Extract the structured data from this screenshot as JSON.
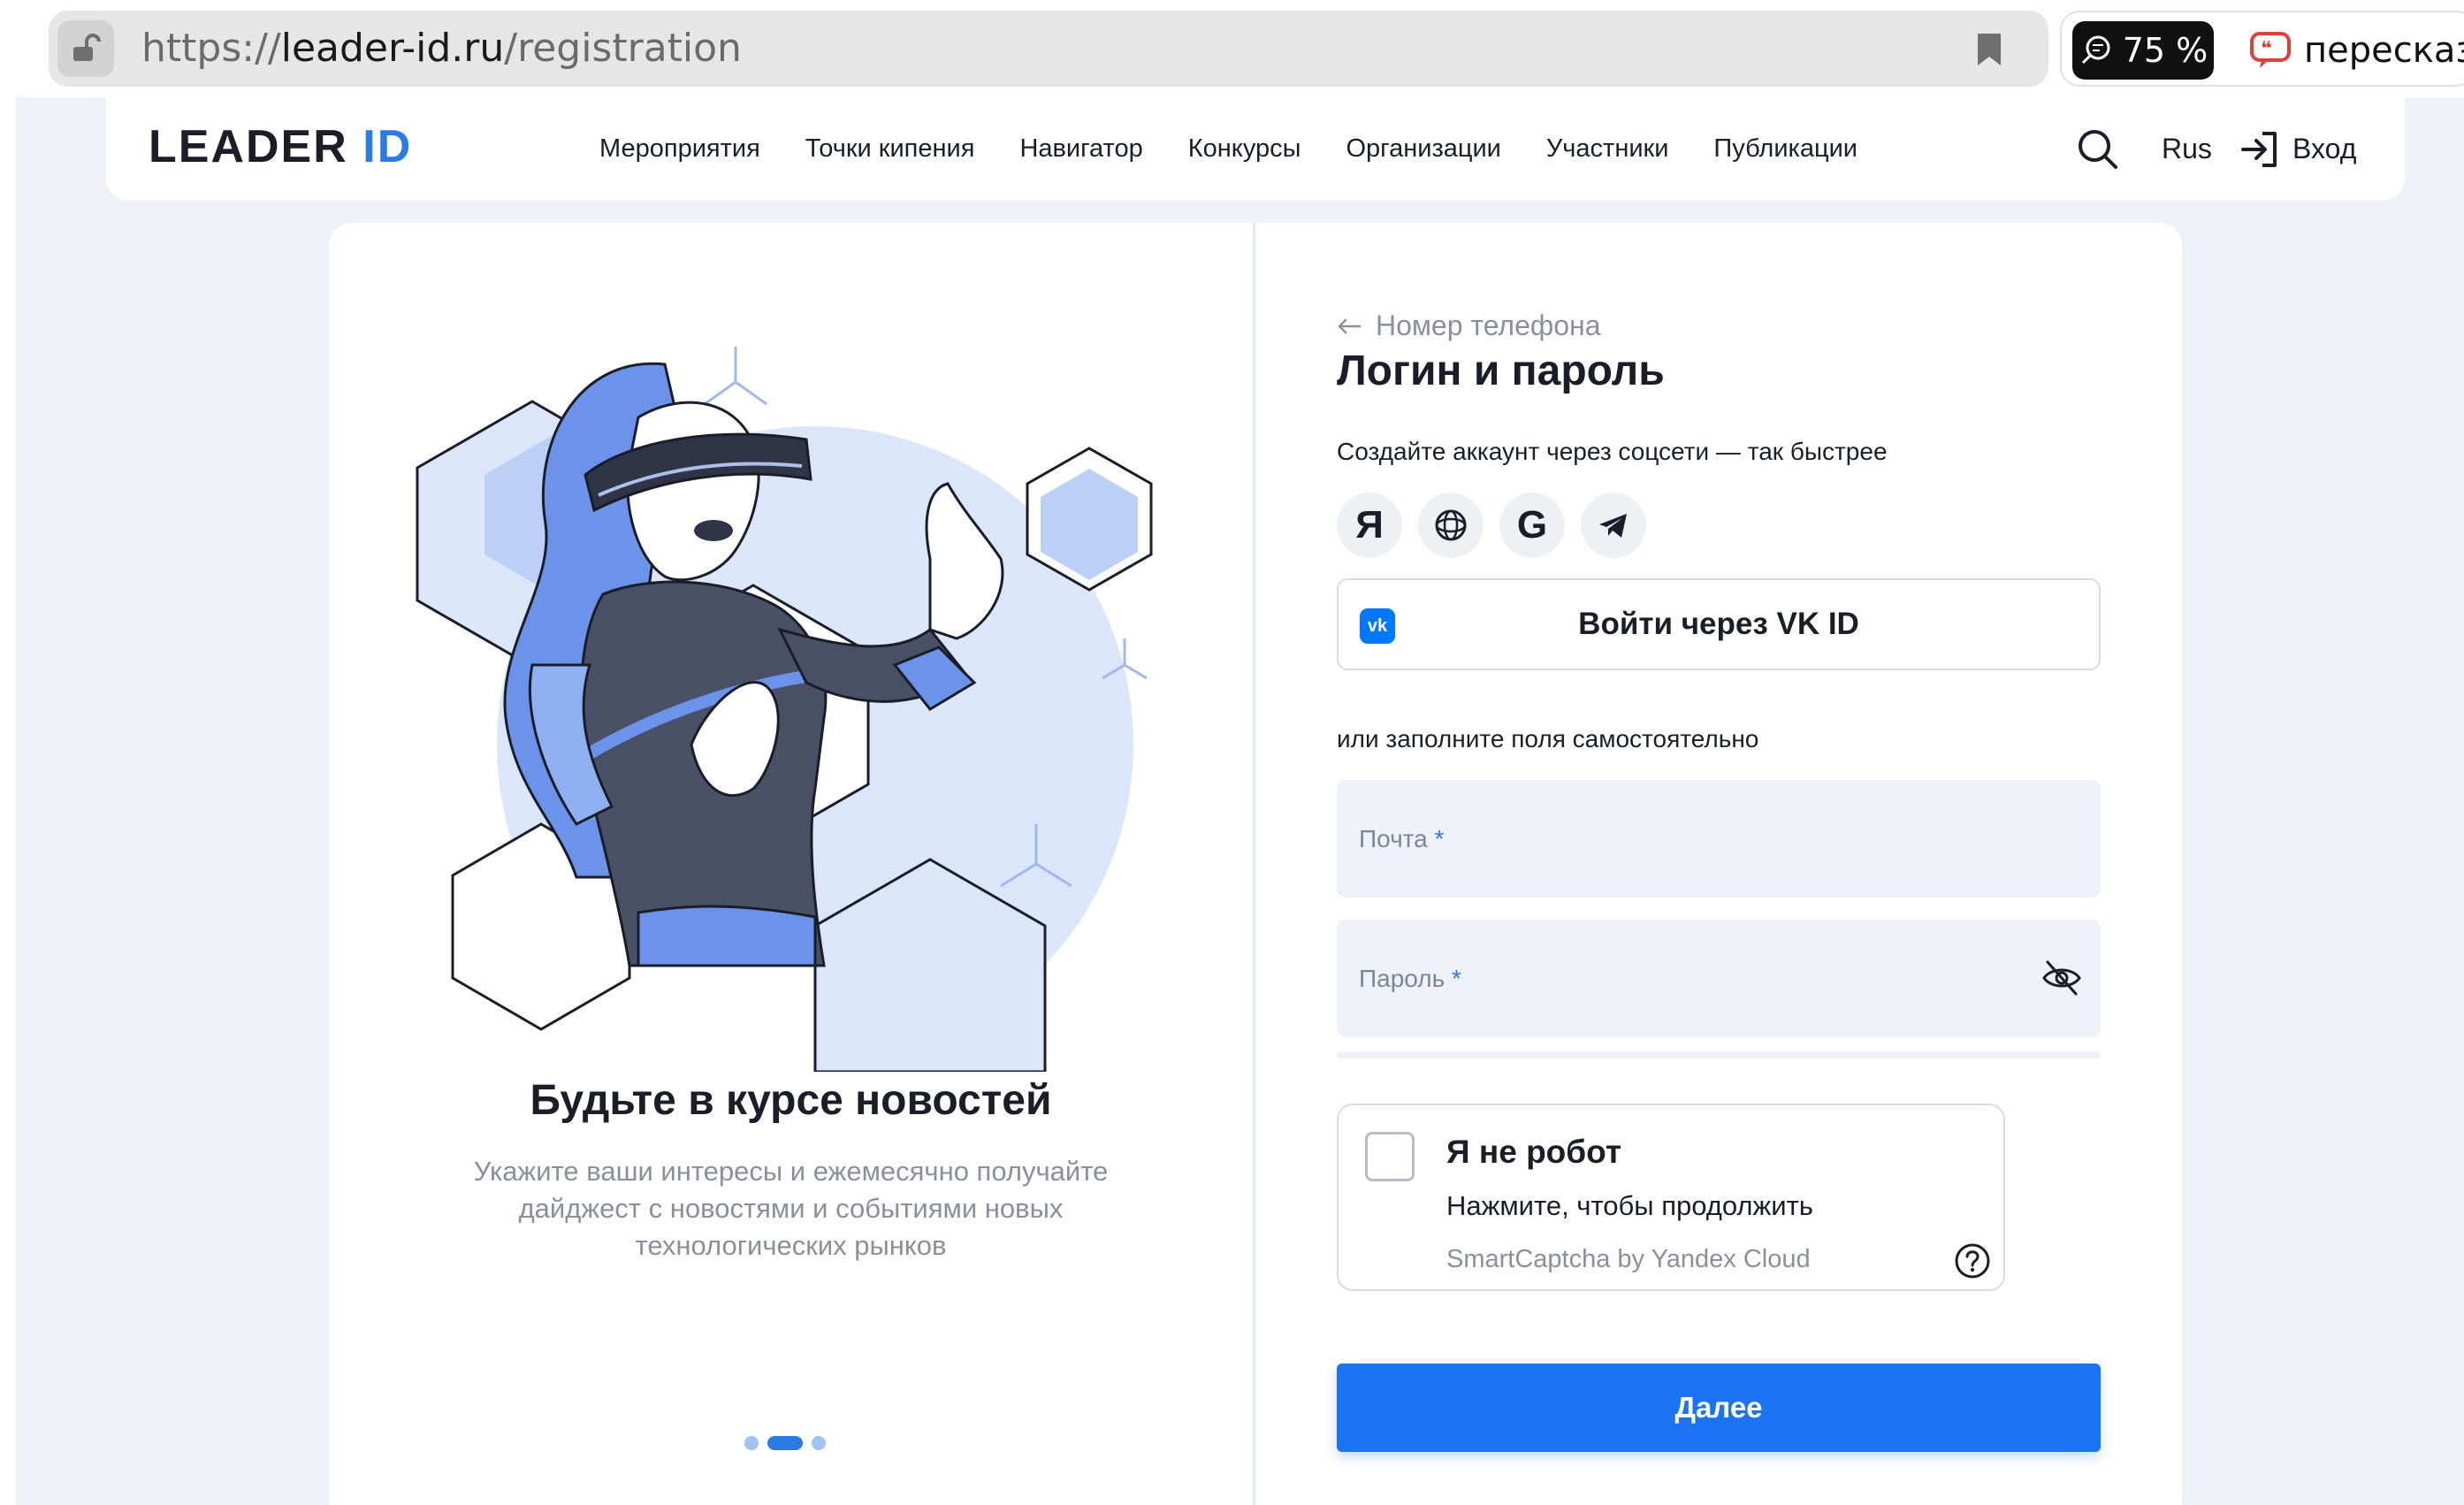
{
  "browser": {
    "url_scheme": "https://",
    "url_host": "leader-id.ru",
    "url_path": "/registration",
    "zoom": "75 %",
    "retell_label": "пересказат"
  },
  "header": {
    "logo_main": "LEADER",
    "logo_accent": "ID",
    "nav": [
      "Мероприятия",
      "Точки кипения",
      "Навигатор",
      "Конкурсы",
      "Организации",
      "Участники",
      "Публикации"
    ],
    "lang": "Rus",
    "login": "Вход"
  },
  "promo": {
    "title": "Будьте в курсе новостей",
    "text": "Укажите ваши интересы и ежемесячно получайте дайджест с новостями и событиями новых технологических рынков",
    "slide_count": 3,
    "active_slide": 2
  },
  "form": {
    "back_label": "Номер телефона",
    "title": "Логин и пароль",
    "social_label": "Создайте аккаунт через соцсети — так быстрее",
    "social": [
      "yandex-icon",
      "openid-icon",
      "google-icon",
      "telegram-icon"
    ],
    "yandex_glyph": "Я",
    "google_glyph": "G",
    "vk_badge": "vk",
    "vk_button": "Войти через VK ID",
    "or_label": "или заполните поля самостоятельно",
    "email_label": "Почта",
    "password_label": "Пароль",
    "required_mark": "*",
    "submit": "Далее"
  },
  "captcha": {
    "title": "Я не робот",
    "subtitle": "Нажмите, чтобы продолжить",
    "brand": "SmartCaptcha by Yandex Cloud"
  },
  "colors": {
    "accent": "#2c7be5",
    "button": "#1a73f0",
    "field_bg": "#eef1f7",
    "page_bg": "#eef1f7"
  }
}
